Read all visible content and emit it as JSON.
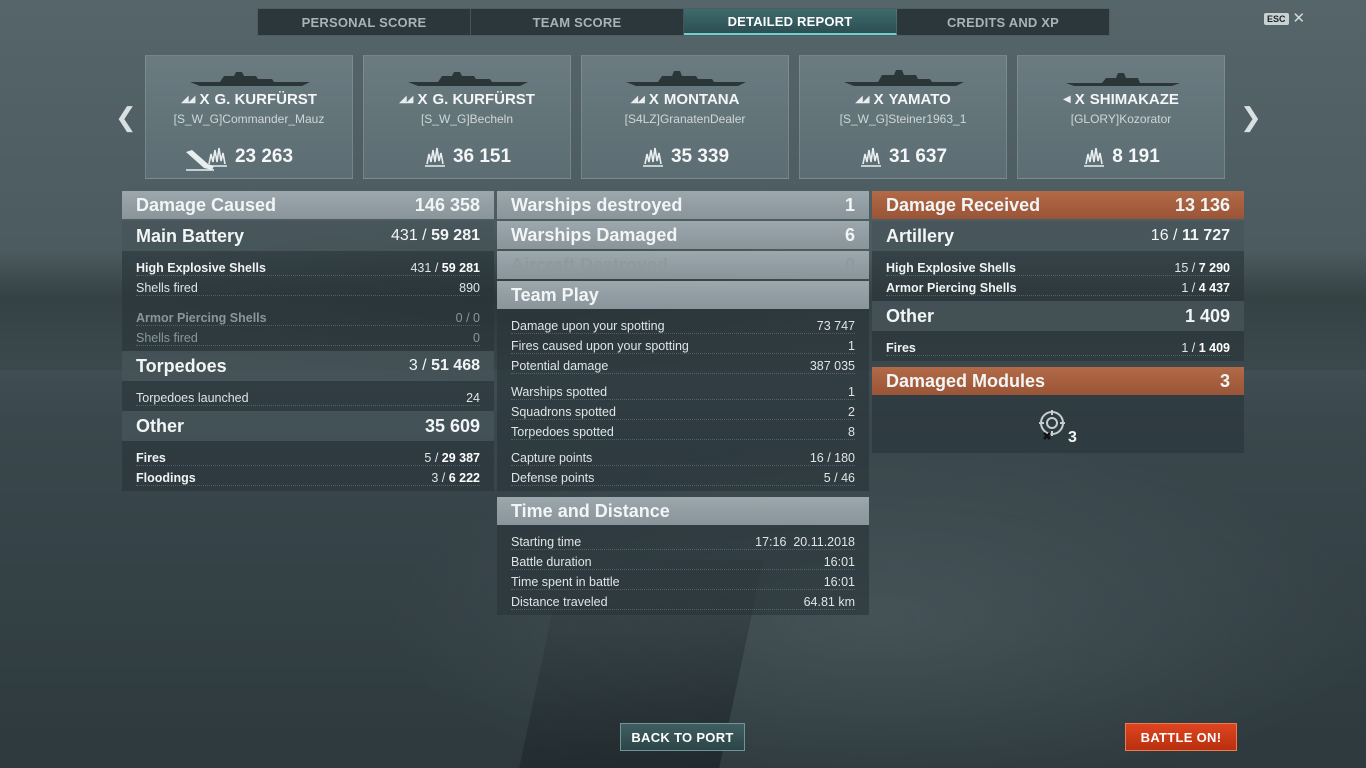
{
  "tabs": [
    {
      "label": "PERSONAL SCORE"
    },
    {
      "label": "TEAM SCORE"
    },
    {
      "label": "DETAILED REPORT"
    },
    {
      "label": "CREDITS AND XP"
    }
  ],
  "esc": {
    "key": "ESC",
    "close": "✕"
  },
  "nav": {
    "prev": "❮",
    "next": "❯"
  },
  "cards": [
    {
      "tier": "X",
      "ship": "G. KURFÜRST",
      "player": "[S_W_G]Commander_Mauz",
      "score": "23 263",
      "sunk": true
    },
    {
      "tier": "X",
      "ship": "G. KURFÜRST",
      "player": "[S_W_G]Becheln",
      "score": "36 151"
    },
    {
      "tier": "X",
      "ship": "MONTANA",
      "player": "[S4LZ]GranatenDealer",
      "score": "35 339"
    },
    {
      "tier": "X",
      "ship": "YAMATO",
      "player": "[S_W_G]Steiner1963_1",
      "score": "31 637"
    },
    {
      "tier": "X",
      "ship": "SHIMAKAZE",
      "player": "[GLORY]Kozorator",
      "score": "8 191"
    }
  ],
  "damage_caused": {
    "title": "Damage Caused",
    "total": "146 358",
    "main_battery": {
      "title": "Main Battery",
      "hits": "431 / ",
      "dmg": "59 281"
    },
    "he": {
      "label": "High Explosive Shells",
      "hits": "431 / ",
      "dmg": "59 281"
    },
    "he_fired": {
      "label": "Shells fired",
      "value": "890"
    },
    "ap": {
      "label": "Armor Piercing Shells",
      "hits": "0 / ",
      "dmg": "0"
    },
    "ap_fired": {
      "label": "Shells fired",
      "value": "0"
    },
    "torpedoes": {
      "title": "Torpedoes",
      "hits": "3 / ",
      "dmg": "51 468"
    },
    "torp_launched": {
      "label": "Torpedoes launched",
      "value": "24"
    },
    "other": {
      "title": "Other",
      "total": "35 609"
    },
    "fires": {
      "label": "Fires",
      "hits": "5 / ",
      "dmg": "29 387"
    },
    "floodings": {
      "label": "Floodings",
      "hits": "3 / ",
      "dmg": "6 222"
    }
  },
  "middle": {
    "warships_destroyed": {
      "label": "Warships destroyed",
      "value": "1"
    },
    "warships_damaged": {
      "label": "Warships Damaged",
      "value": "6"
    },
    "aircraft_destroyed": {
      "label": "Aircraft Destroyed",
      "value": "0"
    },
    "team_play": {
      "title": "Team Play",
      "rows": [
        {
          "label": "Damage upon your spotting",
          "value": "73 747"
        },
        {
          "label": "Fires caused upon your spotting",
          "value": "1"
        },
        {
          "label": "Potential damage",
          "value": "387 035"
        },
        {
          "label": "Warships spotted",
          "value": "1"
        },
        {
          "label": "Squadrons spotted",
          "value": "2"
        },
        {
          "label": "Torpedoes spotted",
          "value": "8"
        },
        {
          "label": "Capture points",
          "value": "16 / 180"
        },
        {
          "label": "Defense points",
          "value": "5 / 46"
        }
      ]
    },
    "time_distance": {
      "title": "Time and Distance",
      "rows": [
        {
          "label": "Starting time",
          "value": "17:16  20.11.2018"
        },
        {
          "label": "Battle duration",
          "value": "16:01"
        },
        {
          "label": "Time spent in battle",
          "value": "16:01"
        },
        {
          "label": "Distance traveled",
          "value": "64.81 km"
        }
      ]
    }
  },
  "damage_received": {
    "title": "Damage Received",
    "total": "13 136",
    "artillery": {
      "title": "Artillery",
      "hits": "16 / ",
      "dmg": "11 727"
    },
    "he": {
      "label": "High Explosive Shells",
      "hits": "15 / ",
      "dmg": "7 290"
    },
    "ap": {
      "label": "Armor Piercing Shells",
      "hits": "1 / ",
      "dmg": "4 437"
    },
    "other": {
      "title": "Other",
      "total": "1 409"
    },
    "fires": {
      "label": "Fires",
      "hits": "1 / ",
      "dmg": "1 409"
    },
    "modules": {
      "title": "Damaged Modules",
      "count": "3",
      "icon_count": "3"
    }
  },
  "buttons": {
    "back_to_port": "BACK TO PORT",
    "battle_on": "BATTLE ON!"
  },
  "colors": {
    "accent_tab": "#6fd1cf",
    "header_orange": "#a85e3f",
    "battle_button": "#d23b16"
  }
}
